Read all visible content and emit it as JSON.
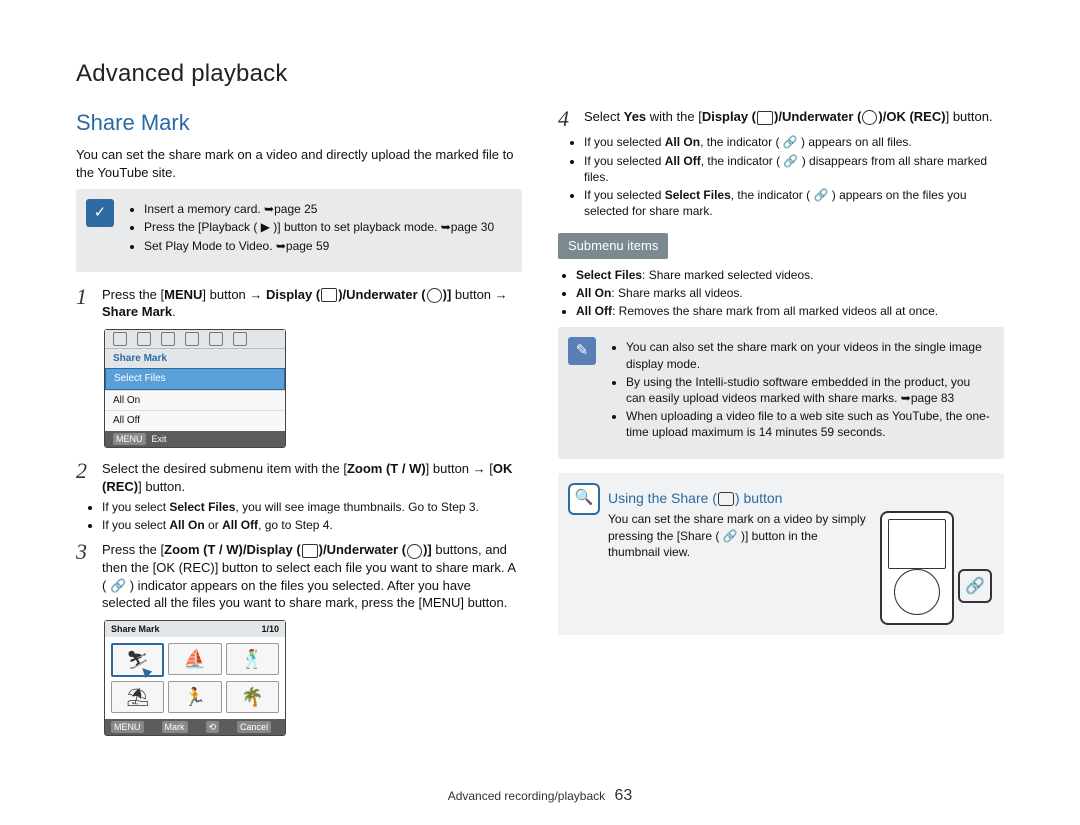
{
  "header": {
    "title": "Advanced playback"
  },
  "section": {
    "heading": "Share Mark",
    "intro": "You can set the share mark on a video and directly upload the marked file to the YouTube site."
  },
  "precheck": {
    "items": [
      "Insert a memory card. ➥page 25",
      "Press the [Playback ( ▶ )] button to set playback mode. ➥page 30",
      "Set Play Mode to Video. ➥page 59"
    ]
  },
  "steps": {
    "s1": {
      "num": "1",
      "l1a": "Press the [",
      "l1b": "] button → ",
      "l1c": " button → ",
      "menu": "MENU",
      "disp_label": "Display (",
      "under_label": ")/Underwater (",
      "close_br": ")]",
      "sharemark": "Share Mark",
      "period": "."
    },
    "s2": {
      "num": "2",
      "text_a": "Select the desired submenu item with the [",
      "zoom": "Zoom (T / W)",
      "text_b": "] button → [",
      "okrec": "OK (REC)",
      "text_c": "] button.",
      "bul1_a": "If you select ",
      "bul1_b": "Select Files",
      "bul1_c": ", you will see image thumbnails. Go to Step 3.",
      "bul2_a": "If you select ",
      "bul2_b": "All On",
      "bul2_c": " or ",
      "bul2_d": "All Off",
      "bul2_e": ", go to Step 4."
    },
    "s3": {
      "num": "3",
      "text_a": "Press the [",
      "zoom": "Zoom (T / W)",
      "slash": "/",
      "disp": "Display (",
      "under": ")/Underwater (",
      "close": ")]",
      "rest": " buttons, and then the [OK (REC)] button to select each file you want to share mark. A ( 🔗 ) indicator appears on the files you selected. After you have selected all the files you want to share mark, press the [MENU] button."
    },
    "s4": {
      "num": "4",
      "text_a": "Select ",
      "yes": "Yes",
      "text_b": " with the [",
      "disp": "Display (",
      "under": ")/Underwater (",
      "okrec": ")/OK (REC)",
      "close": "]",
      "text_c": " button.",
      "bul1_a": "If you selected ",
      "bul1_b": "All On",
      "bul1_c": ", the indicator ( 🔗 ) appears on all files.",
      "bul2_a": "If you selected ",
      "bul2_b": "All Off",
      "bul2_c": ", the indicator ( 🔗 ) disappears from all share marked files.",
      "bul3_a": "If you selected ",
      "bul3_b": "Select Files",
      "bul3_c": ", the indicator ( 🔗 ) appears on the files you selected for share mark."
    }
  },
  "ui_menu": {
    "header": "Share Mark",
    "rows": [
      "Select Files",
      "All On",
      "All Off"
    ],
    "footer_tag": "MENU",
    "footer_label": "Exit"
  },
  "ui_thumbs": {
    "title": "Share Mark",
    "counter": "1/10",
    "footer_mark_tag": "MENU",
    "footer_mark": "Mark",
    "footer_cancel_tag": "⟲",
    "footer_cancel": "Cancel"
  },
  "submenu": {
    "chip": "Submenu items",
    "b1_a": "Select Files",
    "b1_b": ": Share marked selected videos.",
    "b2_a": "All On",
    "b2_b": ": Share marks all videos.",
    "b3_a": "All Off",
    "b3_b": ": Removes the share mark from all marked videos all at once."
  },
  "tipbox": {
    "b1": "You can also set the share mark on your videos in the single image display mode.",
    "b2": "By using the Intelli-studio software embedded in the product, you can easily upload videos marked with share marks. ➥page 83",
    "b3": "When uploading a video file to a web site such as YouTube, the one-time upload maximum is 14 minutes 59 seconds."
  },
  "using": {
    "heading_a": "Using the Share (",
    "heading_b": ") button",
    "text": "You can set the share mark on a video by simply pressing the [Share ( 🔗 )] button in the thumbnail view."
  },
  "footer": {
    "section": "Advanced recording/playback",
    "page": "63"
  }
}
